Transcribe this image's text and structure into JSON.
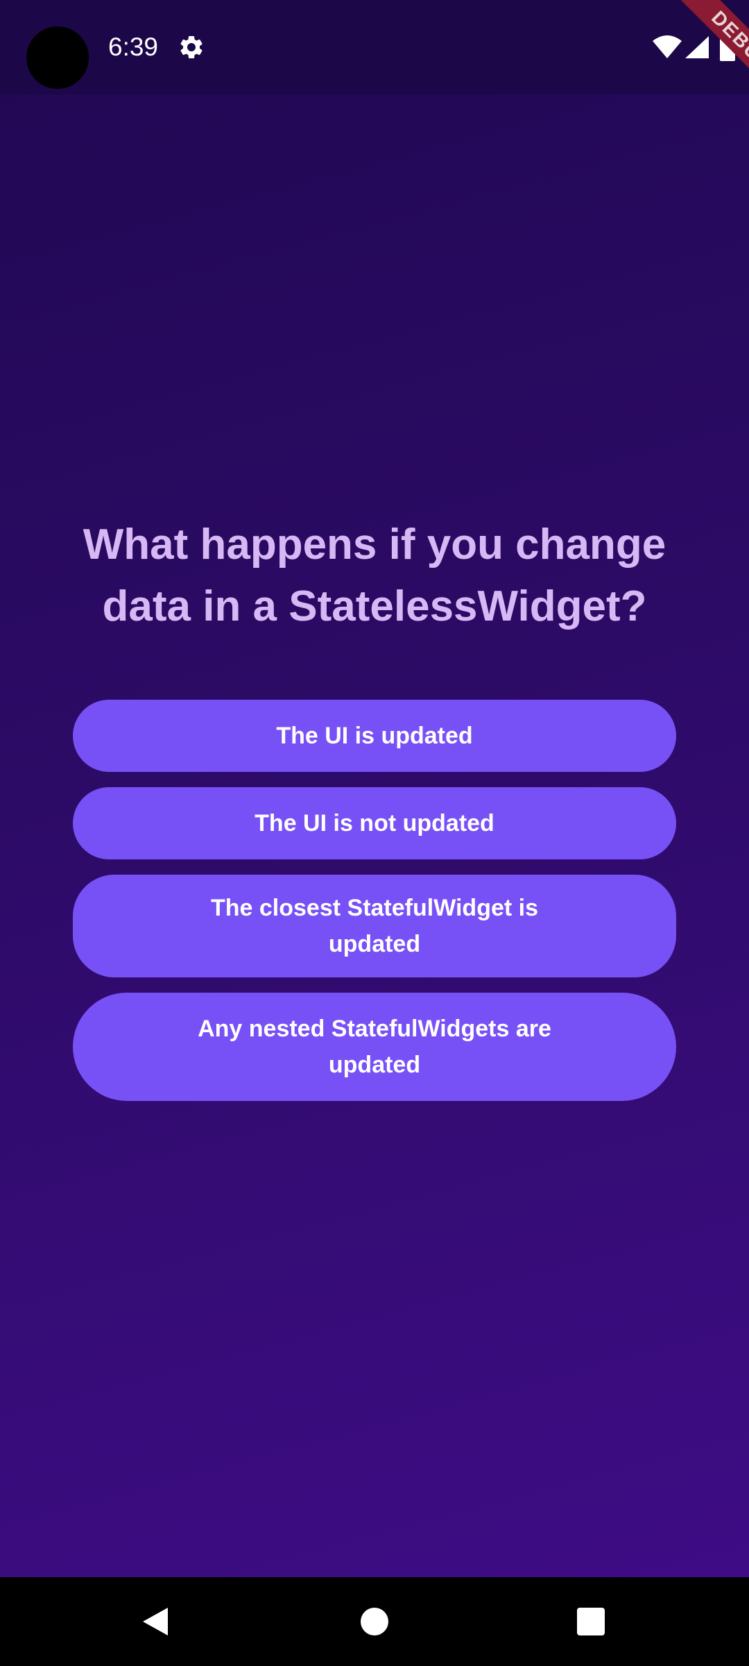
{
  "status_bar": {
    "time": "6:39",
    "icons": [
      "gear-icon",
      "wifi-icon",
      "cellular-signal-icon",
      "battery-icon"
    ]
  },
  "debug_banner": {
    "label": "DEBUG"
  },
  "quiz": {
    "question": "What happens if you change data in a StatelessWidget?",
    "answers": [
      "The UI is updated",
      "The UI is not updated",
      "The closest StatefulWidget is updated",
      "Any nested StatefulWidgets are updated"
    ]
  },
  "nav_bar": {
    "icons": [
      "back-icon",
      "home-icon",
      "recents-icon"
    ]
  },
  "colors": {
    "background_top": "#200752",
    "background_bottom": "#3e0c85",
    "question_text": "#d7b8f5",
    "button": "#7851f6",
    "button_text": "#ffffff",
    "debug_ribbon": "#8b1a33"
  }
}
